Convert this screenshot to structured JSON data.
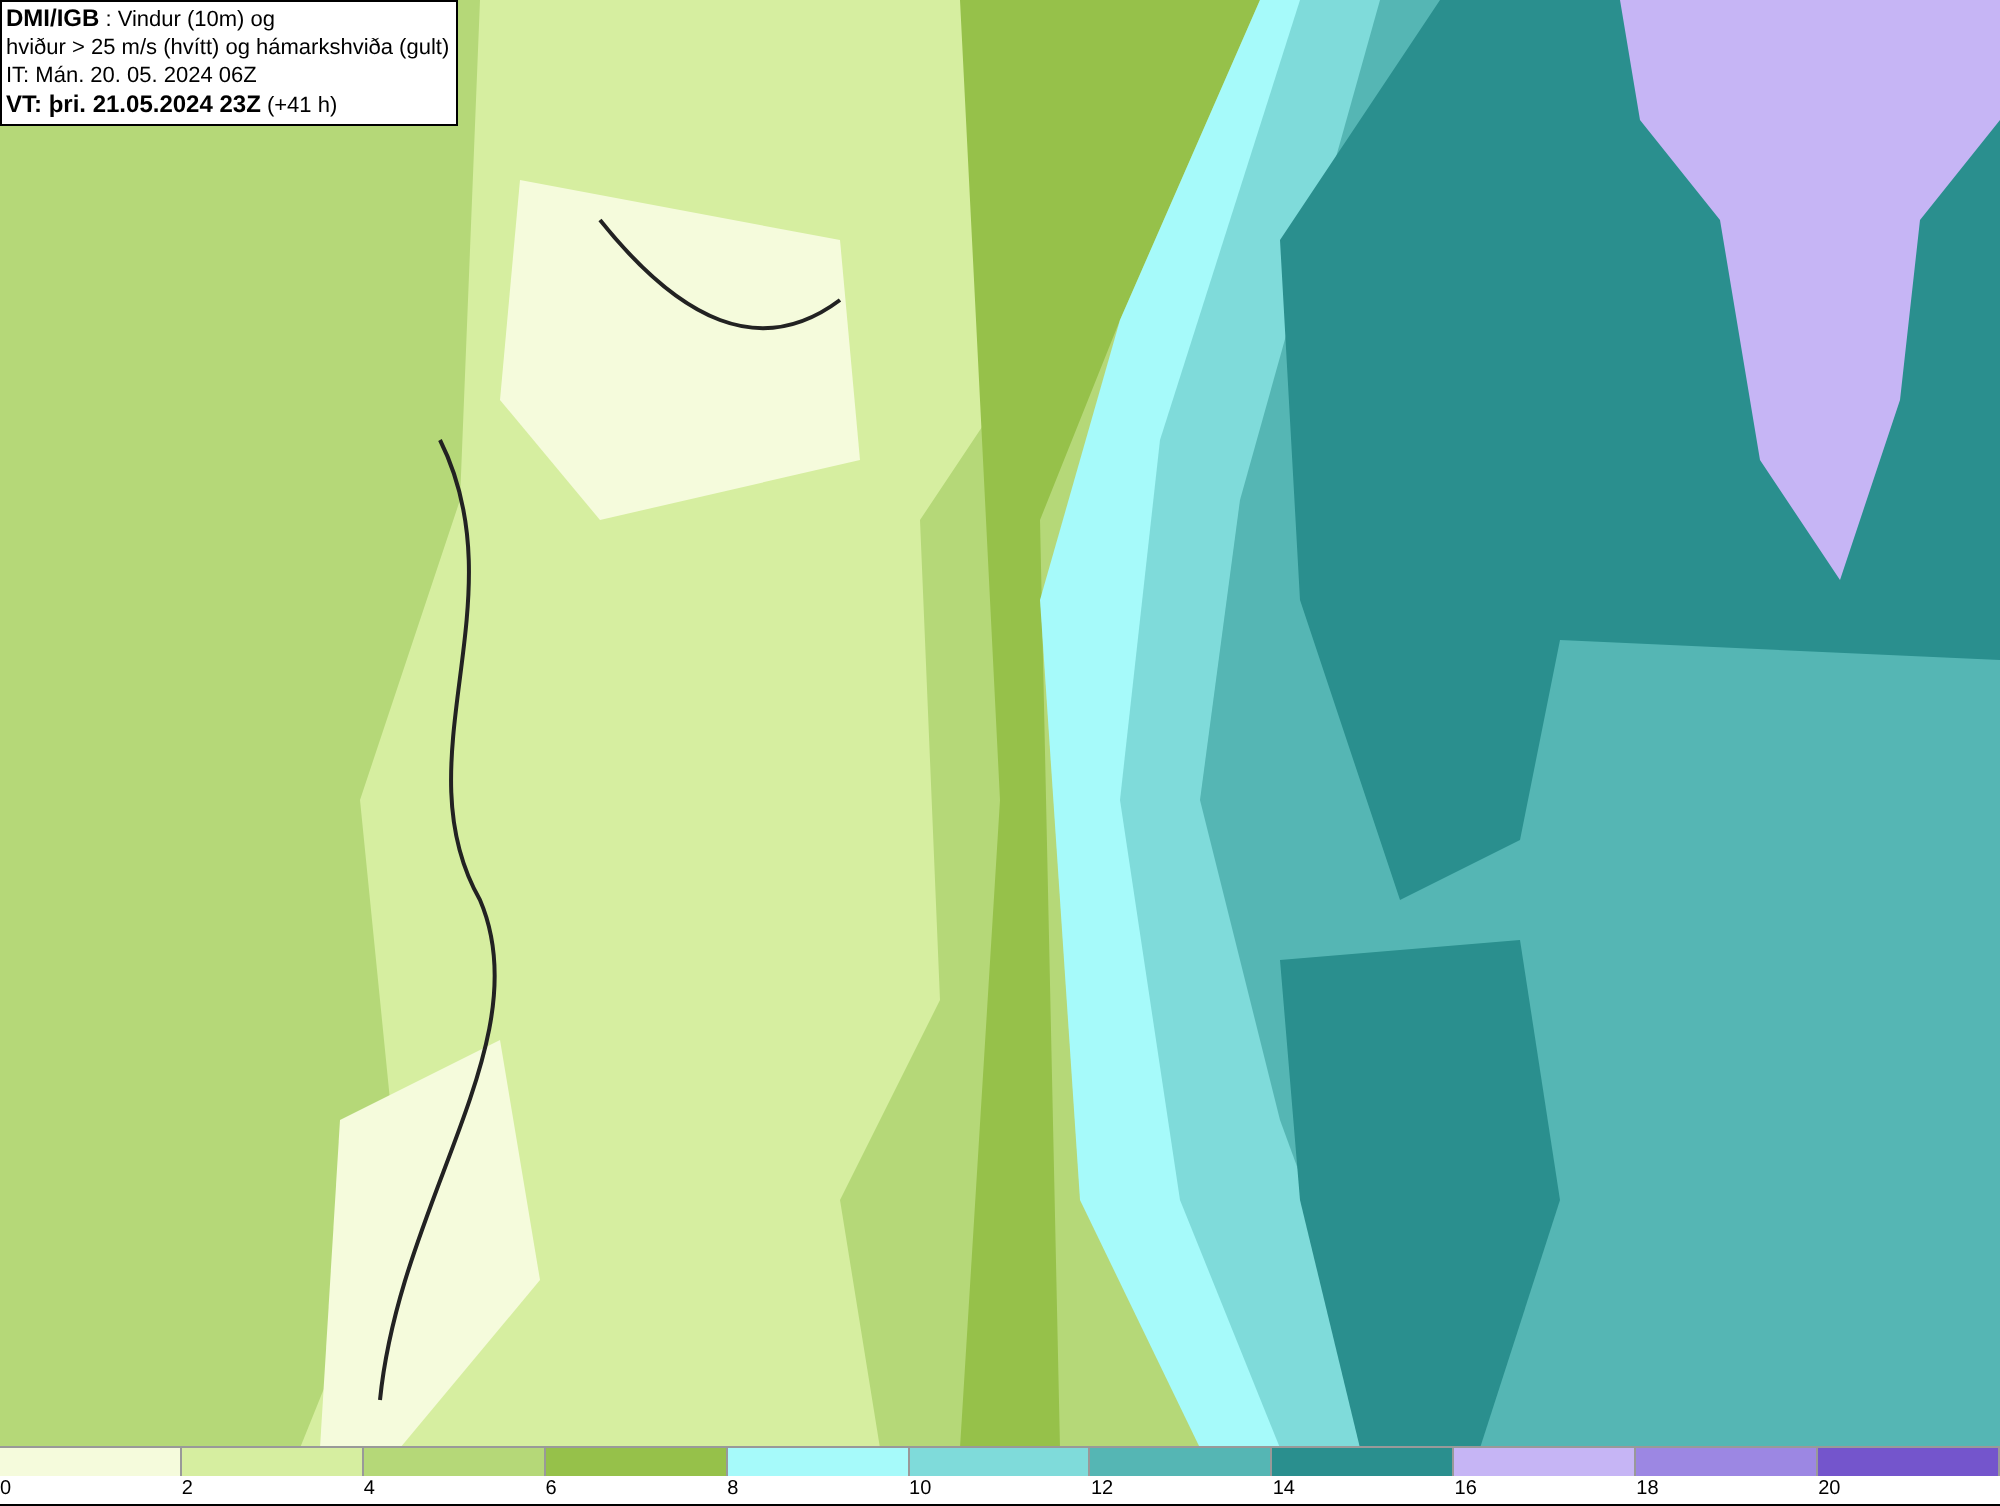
{
  "info_box": {
    "lines": [
      "**DMI/IGB** : Vindur (10m) og",
      "hviður > 25 m/s (hvítt) og hámarkshviða (gult)",
      "IT: Mán. 20. 05. 2024 06Z",
      "**VT: þri. 21.05.2024 23Z** (+41 h)"
    ]
  },
  "legend": [
    {
      "label": "0",
      "color": "#f5fbdc"
    },
    {
      "label": "2",
      "color": "#d6eea0"
    },
    {
      "label": "4",
      "color": "#b5d878"
    },
    {
      "label": "6",
      "color": "#96c14a"
    },
    {
      "label": "8",
      "color": "#a6fafa"
    },
    {
      "label": "10",
      "color": "#7fdbda"
    },
    {
      "label": "12",
      "color": "#55b6b4"
    },
    {
      "label": "14",
      "color": "#2a8f8e"
    },
    {
      "label": "16",
      "color": "#c6b5f5"
    },
    {
      "label": "18",
      "color": "#9c87e3"
    },
    {
      "label": "20",
      "color": "#7455cc"
    }
  ]
}
